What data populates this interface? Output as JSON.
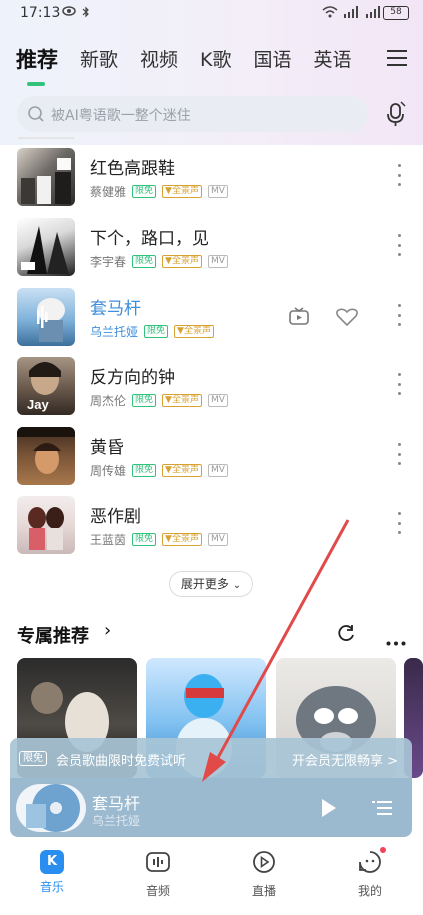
{
  "status_bar": {
    "time": "17:13",
    "battery": "58"
  },
  "tabs": [
    {
      "label": "推荐",
      "active": true
    },
    {
      "label": "新歌"
    },
    {
      "label": "视频"
    },
    {
      "label": "K歌"
    },
    {
      "label": "国语"
    },
    {
      "label": "英语"
    }
  ],
  "search": {
    "placeholder": "被AI粤语歌一整个迷住"
  },
  "songs": [
    {
      "title": "红色高跟鞋",
      "artist": "蔡健雅",
      "badges": [
        "限免",
        "全景声",
        "MV"
      ]
    },
    {
      "title": "下个，路口，见",
      "artist": "李宇春",
      "badges": [
        "限免",
        "全景声",
        "MV"
      ]
    },
    {
      "title": "套马杆",
      "artist": "乌兰托娅",
      "badges": [
        "限免",
        "全景声"
      ],
      "playing": true
    },
    {
      "title": "反方向的钟",
      "artist": "周杰伦",
      "badges": [
        "限免",
        "全景声",
        "MV"
      ]
    },
    {
      "title": "黄昏",
      "artist": "周传雄",
      "badges": [
        "限免",
        "全景声",
        "MV"
      ]
    },
    {
      "title": "恶作剧",
      "artist": "王蓝茵",
      "badges": [
        "限免",
        "全景声",
        "MV"
      ]
    }
  ],
  "expand_button": "展开更多",
  "section": {
    "title": "专属推荐"
  },
  "promo": {
    "tag": "限免",
    "text": "会员歌曲限时免费试听",
    "cta": "开会员无限畅享 >"
  },
  "mini_player": {
    "title": "套马杆",
    "artist": "乌兰托娅"
  },
  "bottom_nav": [
    {
      "label": "音乐",
      "active": true
    },
    {
      "label": "音频"
    },
    {
      "label": "直播"
    },
    {
      "label": "我的"
    }
  ],
  "colors": {
    "accent": "#31c27c",
    "playing": "#3d8edb",
    "nav_active": "#2a8ef0"
  }
}
